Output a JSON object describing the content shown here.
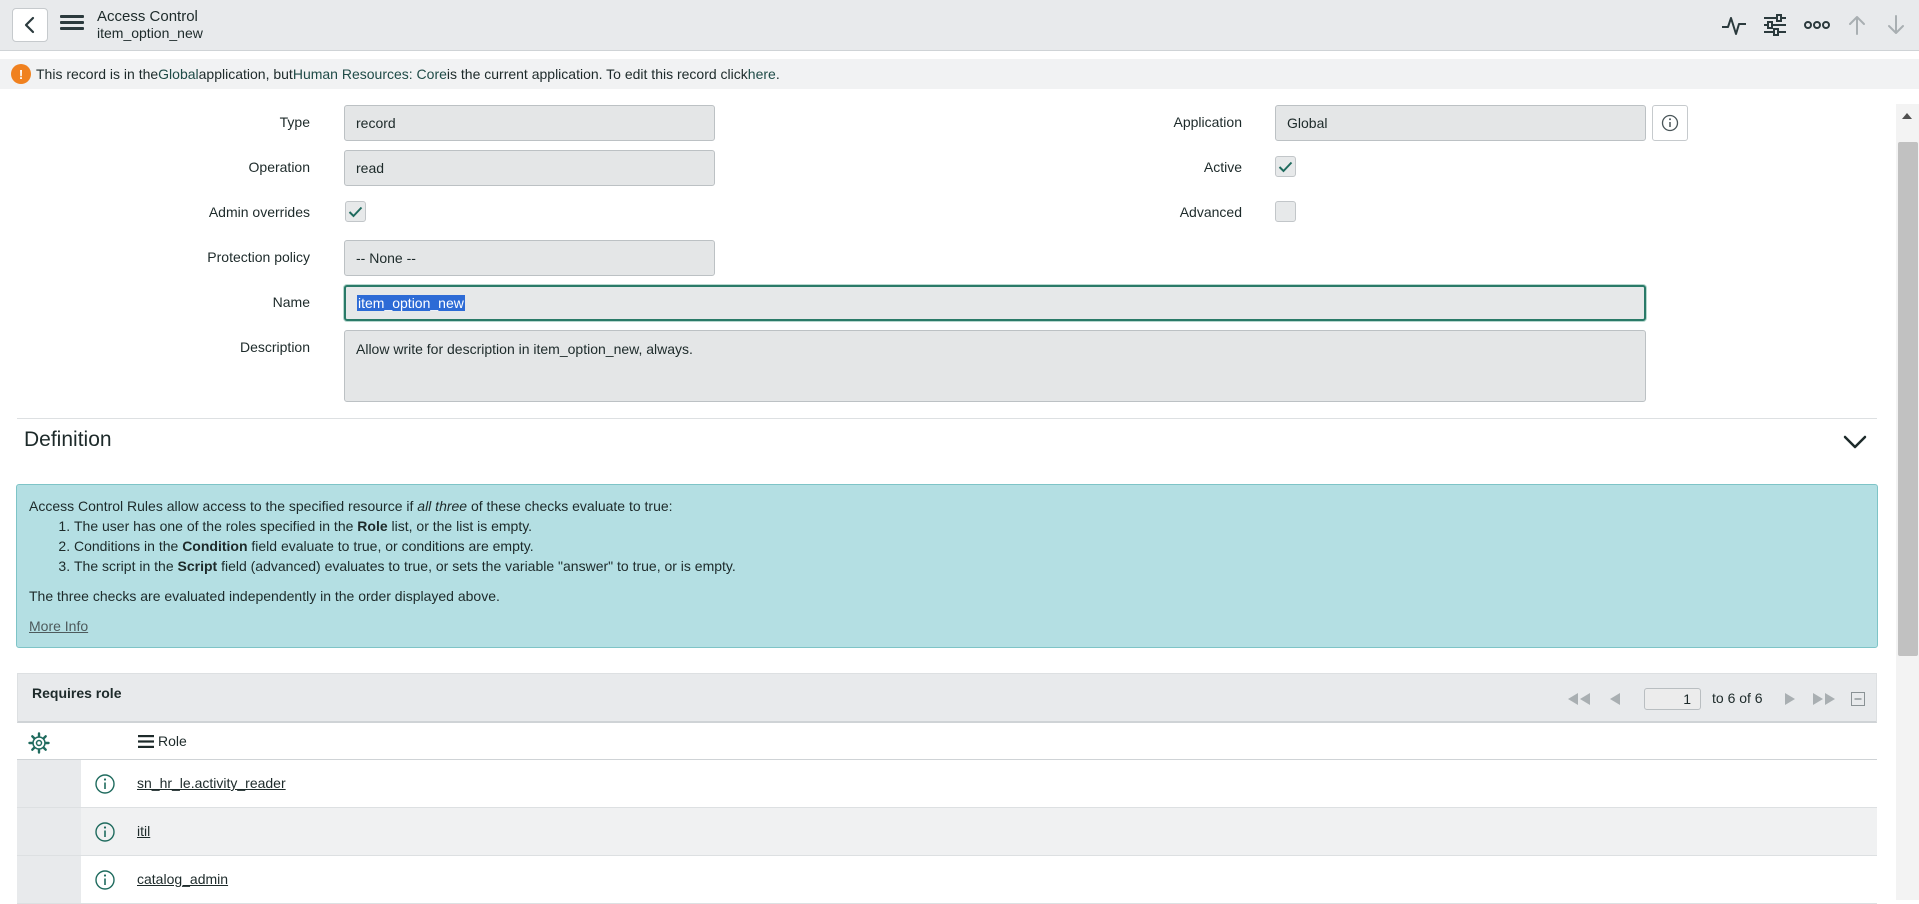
{
  "header": {
    "title": "Access Control",
    "subtitle": "item_option_new",
    "icons": [
      "back-icon",
      "menu-icon",
      "activity-icon",
      "settings-sliders-icon",
      "more-icon",
      "arrow-up-icon",
      "arrow-down-icon"
    ]
  },
  "banner": {
    "icon": "warning-icon",
    "t1": "This record is in the ",
    "app": "Global",
    "t2": " application, but ",
    "current": "Human Resources: Core",
    "t3": " is the current application. To edit this record click ",
    "link": "here",
    "t4": "."
  },
  "form": {
    "type_label": "Type",
    "type_value": "record",
    "operation_label": "Operation",
    "operation_value": "read",
    "admin_overrides_label": "Admin overrides",
    "admin_overrides_checked": true,
    "protection_label": "Protection policy",
    "protection_value": "-- None --",
    "name_label": "Name",
    "name_value": "item_option_new",
    "description_label": "Description",
    "description_value": "Allow write for description in item_option_new, always.",
    "application_label": "Application",
    "application_value": "Global",
    "active_label": "Active",
    "active_checked": true,
    "advanced_label": "Advanced",
    "advanced_checked": false
  },
  "definition": {
    "title": "Definition",
    "intro_a": "Access Control Rules allow access to the specified resource if ",
    "intro_em": "all three",
    "intro_b": " of these checks evaluate to true:",
    "items": [
      {
        "a": "The user has one of the roles specified in the ",
        "b": "Role",
        "c": " list, or the list is empty."
      },
      {
        "a": "Conditions in the ",
        "b": "Condition",
        "c": " field evaluate to true, or conditions are empty."
      },
      {
        "a": "The script in the ",
        "b": "Script",
        "c": " field (advanced) evaluates to true, or sets the variable \"answer\" to true, or is empty."
      }
    ],
    "note": "The three checks are evaluated independently in the order displayed above.",
    "more_info": "More Info"
  },
  "related_list": {
    "title": "Requires role",
    "page": "1",
    "page_text": "to 6 of 6",
    "column": "Role",
    "rows": [
      "sn_hr_le.activity_reader",
      "itil",
      "catalog_admin"
    ]
  },
  "colors": {
    "accent": "#2a7a68",
    "banner_warning": "#f0811f",
    "info_box": "#b4dfe3",
    "header_bg": "#e8eaec"
  }
}
